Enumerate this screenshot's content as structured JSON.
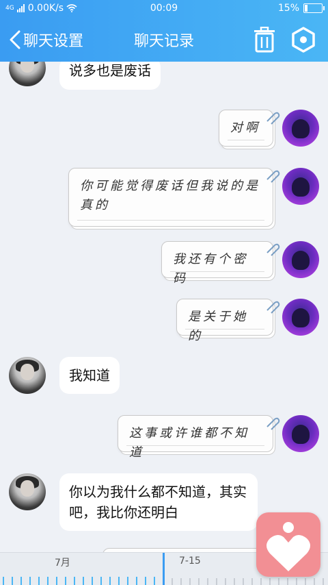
{
  "status_bar": {
    "network_speed": "0.00K/s",
    "time": "00:09",
    "battery": "15%",
    "signal_label": "4G"
  },
  "header": {
    "back_label": "聊天设置",
    "title": "聊天记录",
    "icons": [
      "chevron-left-icon",
      "trash-icon",
      "settings-hexagon-icon"
    ]
  },
  "messages": [
    {
      "from": "friend",
      "text": "说多也是废话"
    },
    {
      "from": "me",
      "text": "对啊"
    },
    {
      "from": "me",
      "text": "你可能觉得废话但我说的是真的"
    },
    {
      "from": "me",
      "text": "我还有个密码"
    },
    {
      "from": "me",
      "text": "是关于她的"
    },
    {
      "from": "friend",
      "text": "我知道"
    },
    {
      "from": "me",
      "text": "这事或许谁都不知道"
    },
    {
      "from": "friend",
      "text": "你以为我什么都不知道，其实吧，我比你还明白"
    }
  ],
  "timeline": {
    "labels": [
      "7月",
      "7-15"
    ]
  },
  "colors": {
    "header_blue": "#3a9cf2",
    "background": "#eef1f6",
    "fab_pink": "#f28f94"
  }
}
